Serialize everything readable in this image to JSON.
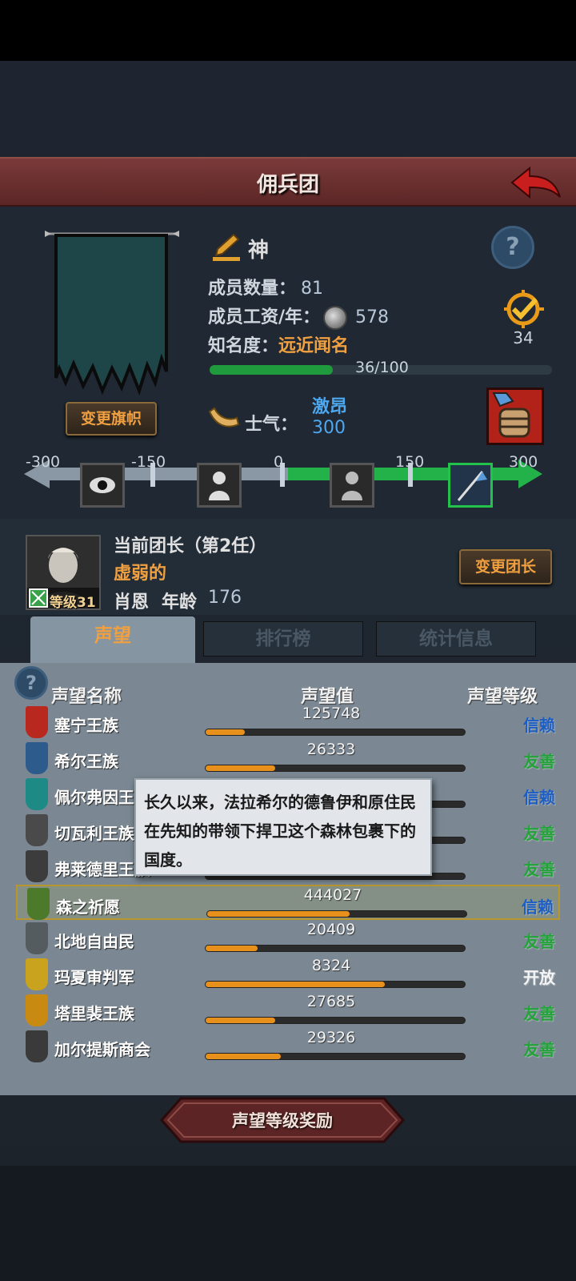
{
  "header": {
    "title": "佣兵团"
  },
  "company": {
    "name": "神",
    "member_label": "成员数量：",
    "member_count": "81",
    "wage_label": "成员工资/年：",
    "wage": "578",
    "fame_label": "知名度：",
    "fame_value": "远近闻名",
    "fame_progress": "36/100",
    "fame_fraction": 0.36,
    "achievement_count": "34",
    "change_banner_label": "变更旗帜"
  },
  "morale": {
    "label": "士气：",
    "state": "激昂",
    "value": "300",
    "scale_ticks": [
      "-300",
      "-150",
      "0",
      "150",
      "300"
    ]
  },
  "leader": {
    "title": "当前团长（第2任）",
    "trait": "虚弱的",
    "name": "肖恩",
    "age_label": "年龄",
    "age": "176",
    "level": "等级31",
    "change_leader_label": "变更团长"
  },
  "tabs": [
    {
      "label": "声望"
    },
    {
      "label": "排行榜"
    },
    {
      "label": "统计信息"
    }
  ],
  "list_headers": {
    "name": "声望名称",
    "value": "声望值",
    "level": "声望等级"
  },
  "reputation": [
    {
      "name": "塞宁王族",
      "value": "125748",
      "fill": 0.15,
      "level": "信赖",
      "level_color": "#1c5ec4",
      "icon_color": "#b8281e"
    },
    {
      "name": "希尔王族",
      "value": "26333",
      "fill": 0.27,
      "level": "友善",
      "level_color": "#23a33a",
      "icon_color": "#2d5c8c"
    },
    {
      "name": "佩尔弗因王族",
      "value": "",
      "fill": 0.0,
      "level": "信赖",
      "level_color": "#1c5ec4",
      "icon_color": "#1d8a86"
    },
    {
      "name": "切瓦利王族",
      "value": "",
      "fill": 0.0,
      "level": "友善",
      "level_color": "#23a33a",
      "icon_color": "#4a4a4a"
    },
    {
      "name": "弗莱德里王族",
      "value": "",
      "fill": 0.0,
      "level": "友善",
      "level_color": "#23a33a",
      "icon_color": "#3c3c3c"
    },
    {
      "name": "森之祈愿",
      "value": "444027",
      "fill": 0.55,
      "level": "信赖",
      "level_color": "#1c5ec4",
      "icon_color": "#4c7a2a"
    },
    {
      "name": "北地自由民",
      "value": "20409",
      "fill": 0.2,
      "level": "友善",
      "level_color": "#23a33a",
      "icon_color": "#555c60"
    },
    {
      "name": "玛夏审判军",
      "value": "8324",
      "fill": 0.69,
      "level": "开放",
      "level_color": "#f4f4f4",
      "icon_color": "#c9a21e"
    },
    {
      "name": "塔里裴王族",
      "value": "27685",
      "fill": 0.27,
      "level": "友善",
      "level_color": "#23a33a",
      "icon_color": "#c98a12"
    },
    {
      "name": "加尔提斯商会",
      "value": "29326",
      "fill": 0.29,
      "level": "友善",
      "level_color": "#23a33a",
      "icon_color": "#3a3a3a"
    }
  ],
  "tooltip": {
    "text": "长久以来，法拉希尔的德鲁伊和原住民在先知的带领下捍卫这个森林包裹下的国度。"
  },
  "reward_button": {
    "label": "声望等级奖励"
  }
}
